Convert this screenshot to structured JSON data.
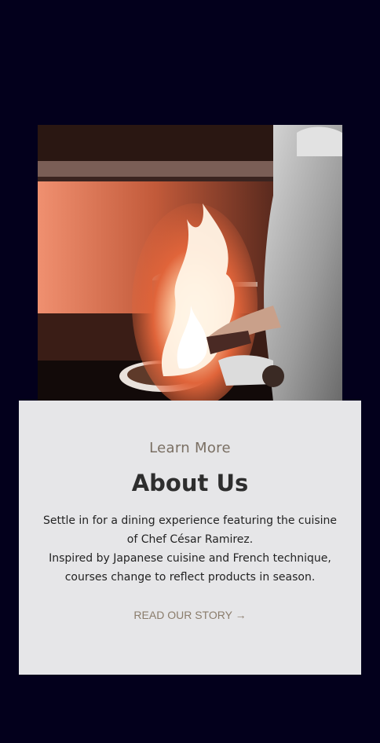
{
  "colors": {
    "page_background": "#03001c",
    "card_background": "#e6e6e8",
    "eyebrow": "#7a6f63",
    "title": "#2e2e2e",
    "link": "#8a7c6b"
  },
  "hero": {
    "image_subject": "chef-flambeing-pan-photo"
  },
  "about": {
    "eyebrow": "Learn More",
    "title": "About Us",
    "paragraph_1": "Settle in for a dining experience featuring the cuisine of Chef César Ramirez.",
    "paragraph_2": "Inspired by Japanese cuisine and French technique, courses change to reflect products in season.",
    "cta_label": "READ OUR STORY →"
  }
}
